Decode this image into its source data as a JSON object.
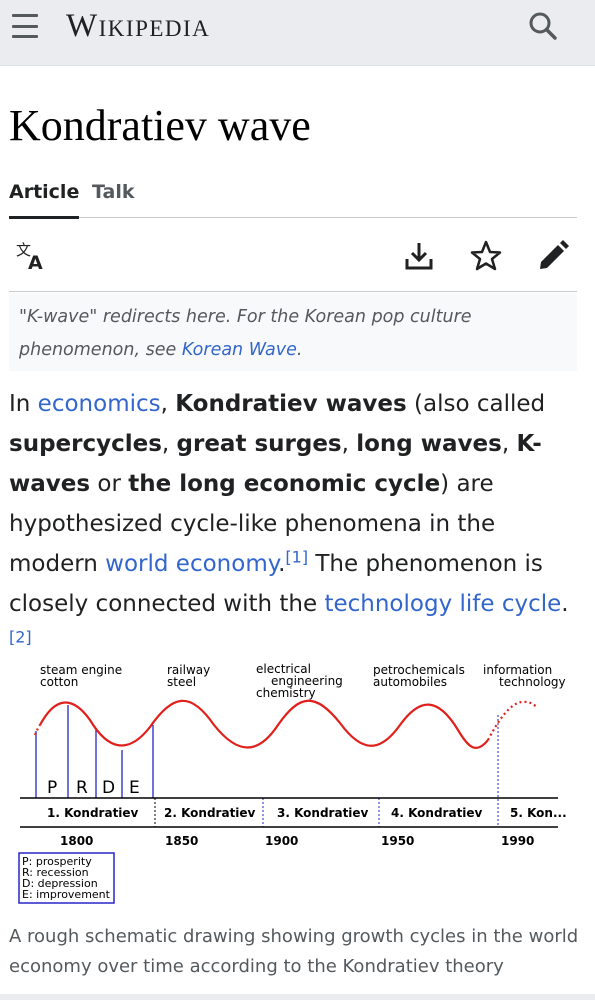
{
  "header": {
    "wordmark": "Wikipedia",
    "menu_icon": "hamburger-menu-icon",
    "search_icon": "search-icon"
  },
  "page": {
    "title": "Kondratiev wave",
    "tabs": [
      {
        "label": "Article",
        "active": true
      },
      {
        "label": "Talk",
        "active": false
      }
    ],
    "actions": [
      "language-icon",
      "download-icon",
      "star-icon",
      "edit-pencil-icon"
    ]
  },
  "hatnote": {
    "text_before": "\"K-wave\" redirects here. For the Korean pop culture phenomenon, see ",
    "link": "Korean Wave",
    "text_after": "."
  },
  "intro": {
    "t1": "In ",
    "l1": "economics",
    "t2": ", ",
    "b1": "Kondratiev waves",
    "t3": " (also called ",
    "b2": "supercycles",
    "t4": ", ",
    "b3": "great surges",
    "t5": ", ",
    "b4": "long waves",
    "t6": ", ",
    "b5": "K-waves",
    "t7": " or ",
    "b6": "the long economic cycle",
    "t8": ") are hypothesized cycle-like phenomena in the modern ",
    "l2": "world economy",
    "t9": ".",
    "ref1": "[1]",
    "t10": " The phenomenon is closely connected with the ",
    "l3": "technology life cycle",
    "t11": ".",
    "ref2": "[2]"
  },
  "figure": {
    "labels_top": [
      {
        "line1": "steam engine",
        "line2": "cotton",
        "line3": ""
      },
      {
        "line1": "railway",
        "line2": "steel",
        "line3": ""
      },
      {
        "line1": "electrical",
        "line2": "engineering",
        "line3": "chemistry"
      },
      {
        "line1": "petrochemicals",
        "line2": "automobiles",
        "line3": ""
      },
      {
        "line1": "information",
        "line2": "technology",
        "line3": ""
      }
    ],
    "phase_letters": [
      "P",
      "R",
      "D",
      "E"
    ],
    "waves": [
      "1. Kondratiev",
      "2. Kondratiev",
      "3. Kondratiev",
      "4. Kondratiev",
      "5. Kon..."
    ],
    "years": [
      "1800",
      "1850",
      "1900",
      "1950",
      "1990"
    ],
    "legend": [
      "P: prosperity",
      "R: recession",
      "D: depression",
      "E: improvement"
    ],
    "colors": {
      "wave": "#e0201b",
      "phase": "#2626c8",
      "axis": "#000000"
    }
  },
  "caption": "A rough schematic drawing showing growth cycles in the world economy over time according to the Kondratiev theory"
}
